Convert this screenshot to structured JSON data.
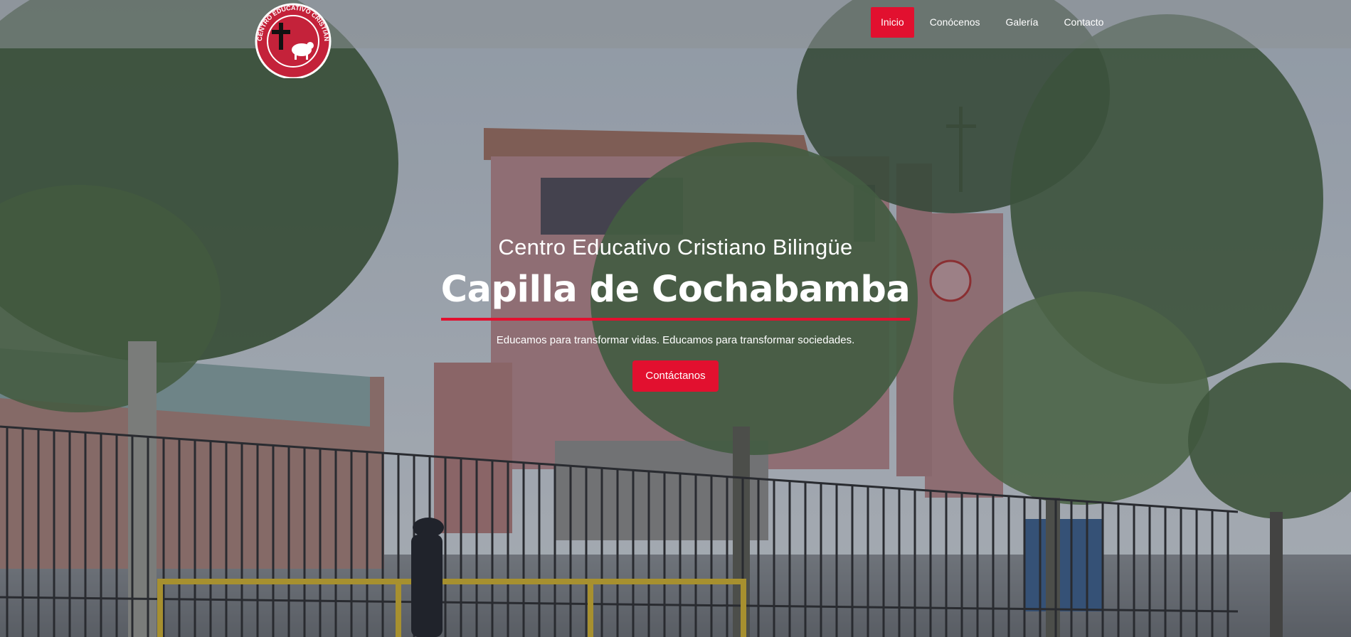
{
  "nav": {
    "items": [
      {
        "label": "Inicio",
        "active": true
      },
      {
        "label": "Conócenos",
        "active": false
      },
      {
        "label": "Galería",
        "active": false
      },
      {
        "label": "Contacto",
        "active": false
      }
    ]
  },
  "logo": {
    "ring_text": "CENTRO EDUCATIVO CRISTIANO BILINGÜE",
    "name_text": "Capilla de Cochabamba"
  },
  "hero": {
    "kicker": "Centro Educativo Cristiano Bilingüe",
    "title": "Capilla de Cochabamba",
    "tagline": "Educamos para transformar vidas. Educamos para transformar sociedades.",
    "cta_label": "Contáctanos"
  },
  "colors": {
    "accent": "#e2102f",
    "text": "#ffffff"
  }
}
